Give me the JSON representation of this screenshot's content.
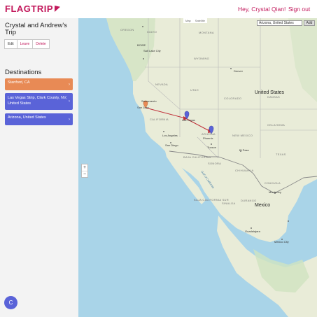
{
  "header": {
    "logo": "FLAGTRIP",
    "greeting": "Hey, Crystal Qian!",
    "signout": "Sign out"
  },
  "trip": {
    "title": "Crystal and Andrew's Trip",
    "buttons": {
      "edit": "Edit",
      "leave": "Leave",
      "delete": "Delete"
    }
  },
  "destinations": {
    "heading": "Destinations",
    "items": [
      {
        "label": "Stanford, CA",
        "color": "#e88a55"
      },
      {
        "label": "Las Vegas Strip, Clark County, NV, United States",
        "color": "#5a63d8"
      },
      {
        "label": "Arizona, United States",
        "color": "#5a63d8"
      }
    ]
  },
  "user": {
    "avatar_initial": "C"
  },
  "map": {
    "search_value": "Arizona, United States",
    "add_label": "Add",
    "zoom_in": "+",
    "zoom_out": "−",
    "map_type": {
      "map": "Map",
      "satellite": "Satellite"
    },
    "labels": {
      "united_states": "United States",
      "mexico": "Mexico",
      "san_jose": "San Jose",
      "sacramento": "Sacramento",
      "las_vegas": "Las Vegas",
      "los_angeles": "Los Angeles",
      "san_diego": "San Diego",
      "phoenix": "Phoenix",
      "tucson": "Tucson",
      "el_paso": "El Paso",
      "denver": "Denver",
      "salt_lake": "Salt Lake City",
      "boise": "BOISE",
      "nevada": "NEVADA",
      "utah": "UTAH",
      "colorado": "COLORADO",
      "arizona": "ARIZONA",
      "new_mexico": "NEW MEXICO",
      "california": "CALIFORNIA",
      "texas": "TEXAS",
      "oregon": "OREGON",
      "idaho": "IDAHO",
      "wyoming": "WYOMING",
      "montana": "MONTANA",
      "kansas": "KANSAS",
      "oklahoma": "OKLAHOMA",
      "sonora": "SONORA",
      "chihuahua": "CHIHUAHUA",
      "baja": "BAJA CALIFORNIA",
      "baja_sur": "BAJA CALIFORNIA SUR",
      "sinaloa": "SINALOA",
      "durango": "DURANGO",
      "coahuila": "COAHUILA",
      "gulf": "Gulf of California",
      "mexico_city": "Mexico City",
      "guadalajara": "Guadalajara",
      "monterrey": "Monterrey"
    }
  }
}
